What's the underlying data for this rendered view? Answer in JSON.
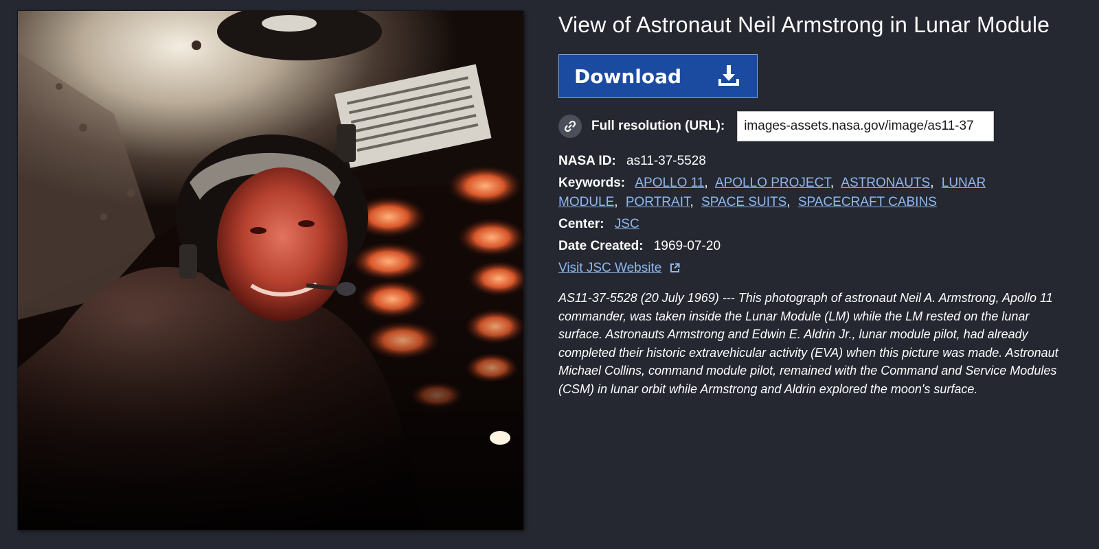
{
  "title": "View of Astronaut Neil Armstrong in Lunar Module",
  "download": {
    "label": "Download",
    "icon": "download-icon"
  },
  "full_resolution": {
    "label": "Full resolution (URL):",
    "value": "images-assets.nasa.gov/image/as11-37",
    "icon": "link-icon"
  },
  "nasa_id": {
    "label": "NASA ID:",
    "value": "as11-37-5528"
  },
  "keywords": {
    "label": "Keywords:",
    "items": [
      "APOLLO 11",
      "APOLLO PROJECT",
      "ASTRONAUTS",
      "LUNAR MODULE",
      "PORTRAIT",
      "SPACE SUITS",
      "SPACECRAFT CABINS"
    ]
  },
  "center": {
    "label": "Center:",
    "value": "JSC"
  },
  "date_created": {
    "label": "Date Created:",
    "value": "1969-07-20"
  },
  "website_link": {
    "label": "Visit JSC Website",
    "icon": "external-link-icon"
  },
  "description": "AS11-37-5528 (20 July 1969) --- This photograph of astronaut Neil A. Armstrong, Apollo 11 commander, was taken inside the Lunar Module (LM) while the LM rested on the lunar surface. Astronauts Armstrong and Edwin E. Aldrin Jr., lunar module pilot, had already completed their historic extravehicular activity (EVA) when this picture was made. Astronaut Michael Collins, command module pilot, remained with the Command and Service Modules (CSM) in lunar orbit while Armstrong and Aldrin explored the moon's surface.",
  "colors": {
    "background": "#252831",
    "button": "#1b4aa1",
    "link": "#8fb8f0"
  }
}
